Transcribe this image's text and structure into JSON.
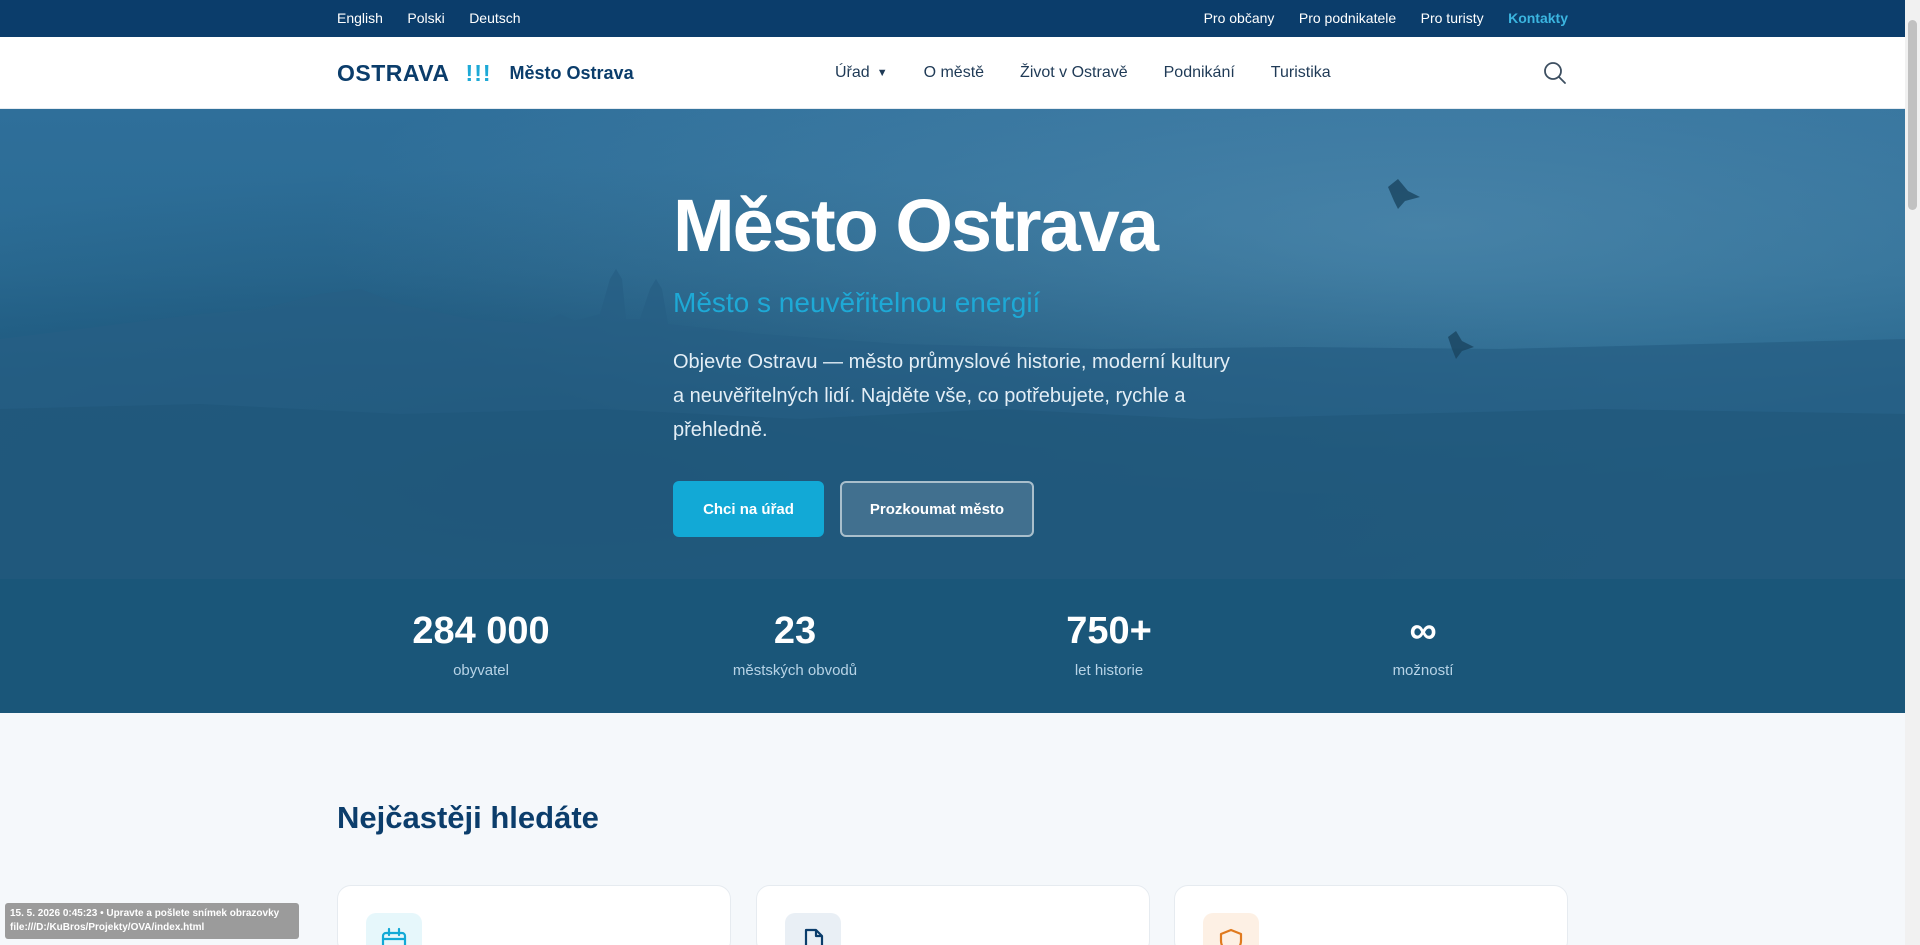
{
  "topbar": {
    "languages": [
      "English",
      "Polski",
      "Deutsch"
    ],
    "audiences": [
      "Pro občany",
      "Pro podnikatele",
      "Pro turisty"
    ],
    "contacts": "Kontakty"
  },
  "header": {
    "logo_word": "OSTRAVA",
    "logo_mark": "!!!",
    "city_name": "Město Ostrava",
    "nav": [
      {
        "label": "Úřad",
        "caret": "▼"
      },
      {
        "label": "O městě"
      },
      {
        "label": "Život v Ostravě"
      },
      {
        "label": "Podnikání"
      },
      {
        "label": "Turistika"
      }
    ],
    "search_icon": "search-icon"
  },
  "hero": {
    "title": "Město Ostrava",
    "subtitle": "Město s neuvěřitelnou energií",
    "lead": "Objevte Ostravu — město průmyslové historie, moderní kultury a neuvěřitelných lidí. Najděte vše, co potřebujete, rychle a přehledně.",
    "primary_cta": "Chci na úřad",
    "secondary_cta": "Prozkoumat město"
  },
  "stats": [
    {
      "value": "284 000",
      "label": "obyvatel"
    },
    {
      "value": "23",
      "label": "městských obvodů"
    },
    {
      "value": "750+",
      "label": "let historie"
    },
    {
      "value": "∞",
      "label": "možností"
    }
  ],
  "section": {
    "title": "Nejčastěji hledáte",
    "cards": [
      {
        "icon": "calendar-icon",
        "icon_color": "#12a9d6",
        "icon_bg": "#e6f7fb"
      },
      {
        "icon": "document-icon",
        "icon_color": "#0b3d6b",
        "icon_bg": "#e9eff5"
      },
      {
        "icon": "shield-icon",
        "icon_color": "#e07a1f",
        "icon_bg": "#fdf0e4"
      }
    ]
  },
  "overlay": {
    "line1": "15. 5. 2026 0:45:23 • Upravte a pošlete snímek obrazovky",
    "line2": "file:///D:/KuBros/Projekty/OVA/index.html"
  },
  "colors": {
    "brand_dark": "#0b3d6b",
    "accent": "#12a9d6",
    "hero_bg": "#2a6b93",
    "stats_bg": "#1a5679"
  }
}
